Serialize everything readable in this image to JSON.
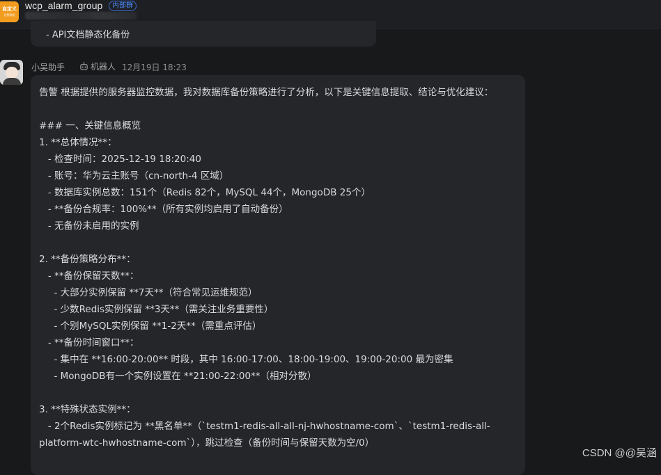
{
  "header": {
    "avatar_line1": "自定义",
    "avatar_line2": "告警群组",
    "group_name": "wcp_alarm_group",
    "group_tag": "内部群"
  },
  "previous_message": {
    "last_line": "- API文档静态化备份"
  },
  "message": {
    "sender": "小吴助手",
    "robot_tag": "机器人",
    "time": "12月19日 18:23",
    "lines": [
      "告警 根据提供的服务器监控数据，我对数据库备份策略进行了分析，以下是关键信息提取、结论与优化建议：",
      "",
      "### 一、关键信息概览",
      "1. **总体情况**：",
      "   - 检查时间：2025-12-19 18:20:40",
      "   - 账号：华为云主账号（cn-north-4 区域）",
      "   - 数据库实例总数：151个（Redis 82个，MySQL 44个，MongoDB 25个）",
      "   - **备份合规率：100%**（所有实例均启用了自动备份）",
      "   - 无备份未启用的实例",
      "",
      "2. **备份策略分布**：",
      "   - **备份保留天数**：",
      "     - 大部分实例保留 **7天**（符合常见运维规范）",
      "     - 少数Redis实例保留 **3天**（需关注业务重要性）",
      "     - 个别MySQL实例保留 **1-2天**（需重点评估）",
      "   - **备份时间窗口**：",
      "     - 集中在 **16:00-20:00** 时段，其中 16:00-17:00、18:00-19:00、19:00-20:00 最为密集",
      "     - MongoDB有一个实例设置在 **21:00-22:00**（相对分散）",
      "",
      "3. **特殊状态实例**：",
      "   - 2个Redis实例标记为 **黑名单**（`testm1-redis-all-all-nj-hwhostname-com`、`testm1-redis-all-",
      "platform-wtc-hwhostname-com`），跳过检查（备份时间与保留天数为空/0）"
    ]
  },
  "watermark": "CSDN @@吴涵"
}
